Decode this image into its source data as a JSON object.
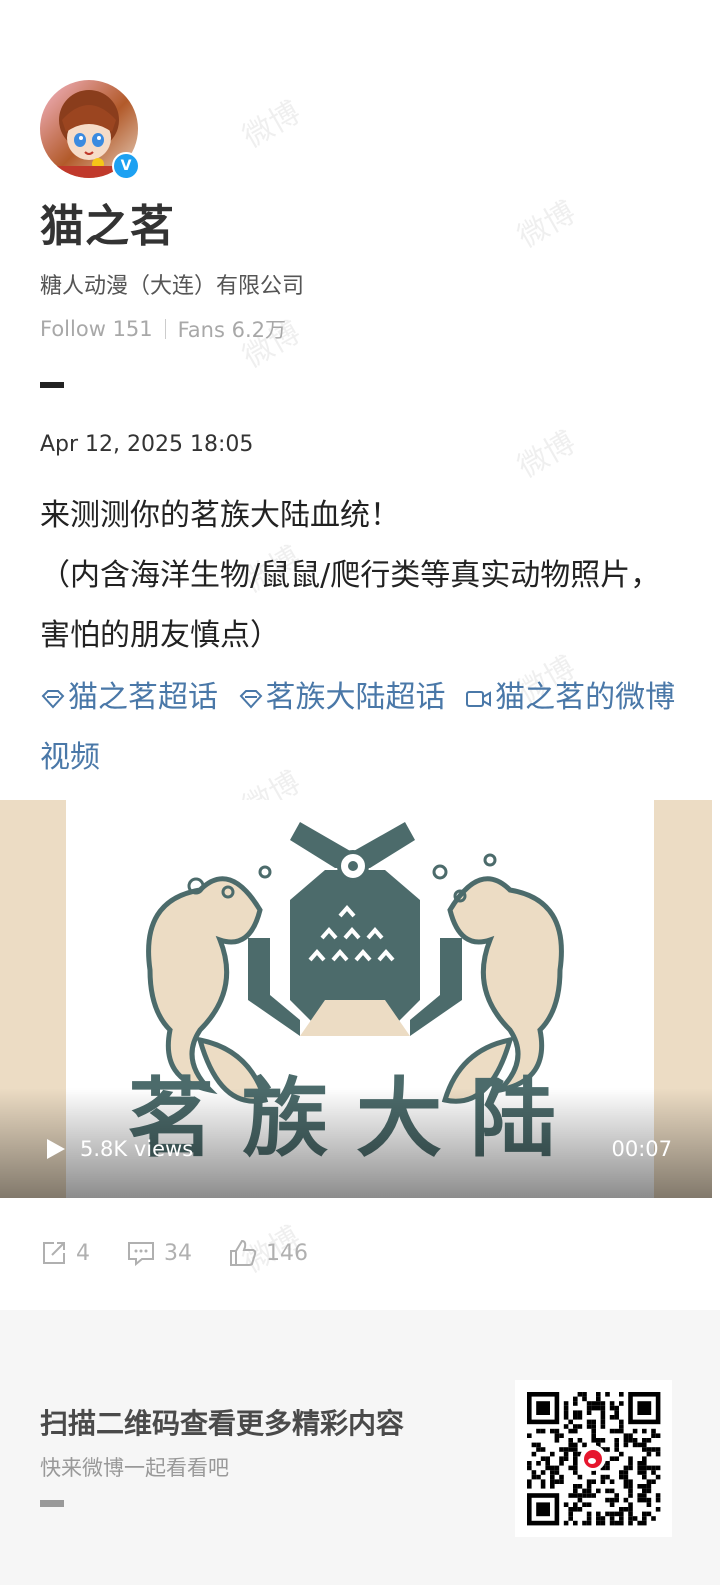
{
  "profile": {
    "name": "猫之茗",
    "company": "糖人动漫（大连）有限公司",
    "follow_label": "Follow",
    "follow_count": "151",
    "fans_label": "Fans",
    "fans_count": "6.2万"
  },
  "post": {
    "date": "Apr 12, 2025 18:05",
    "text_line1": "来测测你的茗族大陆血统！",
    "text_line2": "（内含海洋生物/鼠鼠/爬行类等真实动物照片，害怕的朋友慎点）",
    "tags": [
      {
        "label": "猫之茗超话",
        "icon": "diamond-icon"
      },
      {
        "label": "茗族大陆超话",
        "icon": "diamond-icon"
      },
      {
        "label": "猫之茗的微博视频",
        "icon": "video-camera-icon"
      }
    ]
  },
  "video": {
    "views": "5.8K views",
    "duration": "00:07",
    "poster_text": "茗族大陆"
  },
  "actions": {
    "repost_count": "4",
    "comment_count": "34",
    "like_count": "146"
  },
  "footer": {
    "title": "扫描二维码查看更多精彩内容",
    "subtitle": "快来微博一起看看吧"
  },
  "watermark": "微博",
  "colors": {
    "link": "#4a78a8",
    "poster_teal": "#4c6b6b",
    "poster_beige": "#ecdcc4",
    "verify_blue": "#1da1f2"
  }
}
